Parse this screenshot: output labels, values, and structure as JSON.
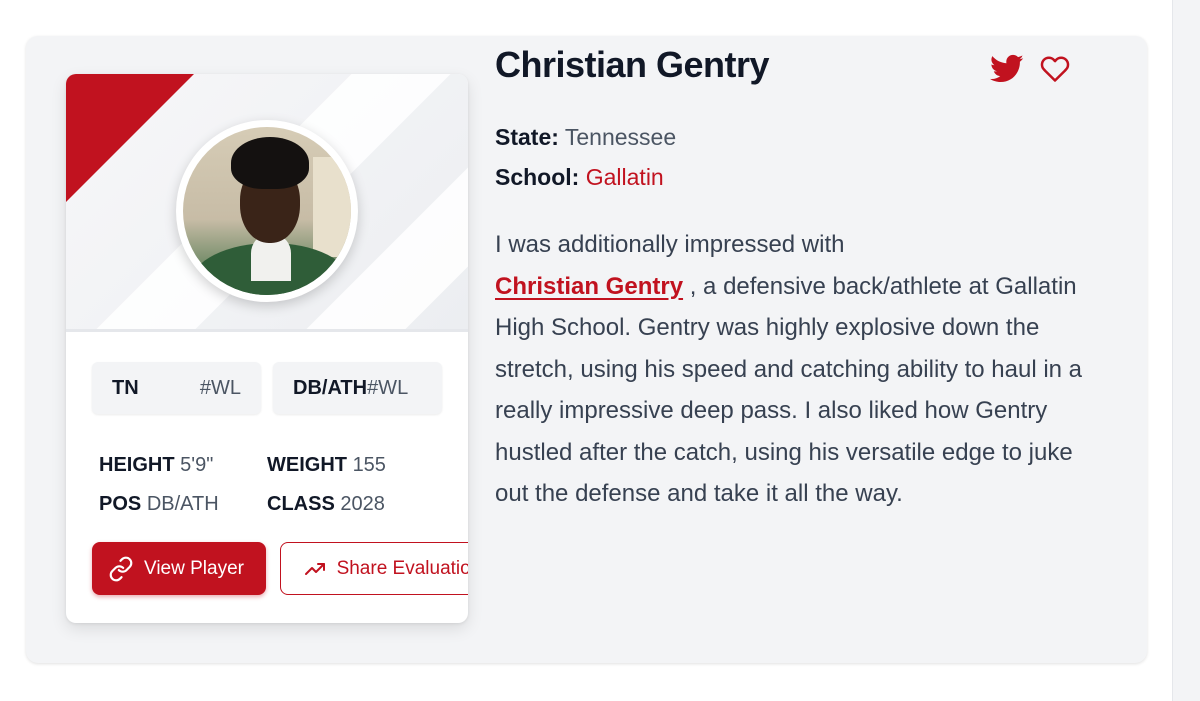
{
  "player": {
    "name": "Christian Gentry",
    "state_label": "State:",
    "state": "Tennessee",
    "school_label": "School:",
    "school": "Gallatin"
  },
  "card": {
    "chip_state": "TN",
    "chip_state_rank": "#WL",
    "chip_position": "DB/ATH",
    "chip_position_rank": "#WL",
    "stats": {
      "height_label": "HEIGHT",
      "height": "5'9\"",
      "weight_label": "WEIGHT",
      "weight": "155",
      "pos_label": "POS",
      "pos": "DB/ATH",
      "class_label": "CLASS",
      "class": "2028"
    },
    "view_player_label": "View Player",
    "share_evaluation_label": "Share Evaluation"
  },
  "icons": {
    "twitter": "twitter-icon",
    "favorite": "heart-icon",
    "link": "link-icon",
    "trend": "trending-up-icon"
  },
  "evaluation": {
    "intro": "I was additionally impressed with",
    "player_link": "Christian Gentry",
    "body": " , a defensive back/athlete at Gallatin High School. Gentry was highly explosive down the stretch, using his speed and catching ability to haul in a really impressive deep pass. I also liked how Gentry hustled after the catch, using his versatile edge to juke out the defense and take it all the way."
  },
  "colors": {
    "accent": "#c1121f",
    "text": "#111827",
    "muted": "#4b5563",
    "card_bg": "#f3f4f6"
  }
}
